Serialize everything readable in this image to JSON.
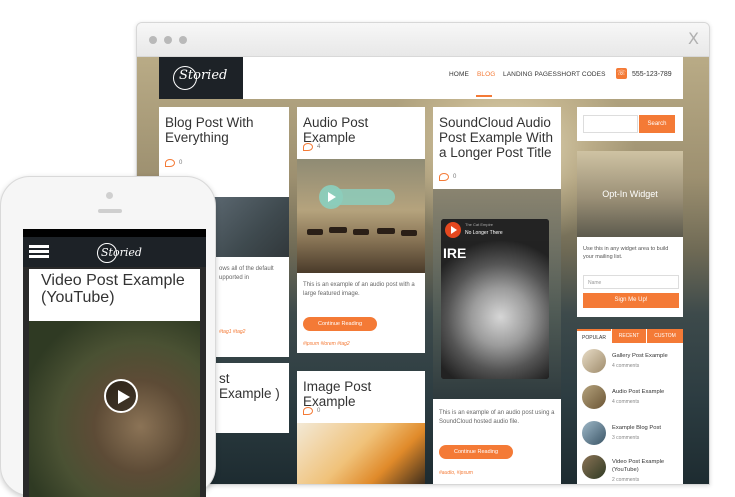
{
  "colors": {
    "accent": "#f47a36",
    "header_dark": "#1d2227"
  },
  "browser": {
    "close_glyph": "X"
  },
  "site": {
    "logo": "Storied",
    "nav": [
      "HOME",
      "BLOG",
      "LANDING PAGES",
      "SHORT CODES"
    ],
    "active_nav": "BLOG",
    "phone_icon": "phone-icon",
    "phone_number": "555-123-789"
  },
  "posts": {
    "blog": {
      "title": "Blog Post With Everything",
      "comments": "0",
      "excerpt": "ows all of the default upported in",
      "tags": "#tag1 #tag2"
    },
    "audio": {
      "title": "Audio Post Example",
      "comments": "4",
      "excerpt": "This is an example of an audio post with a large featured image.",
      "button": "Continue Reading",
      "tags": "#ipsum #lorem #tag2"
    },
    "soundcloud": {
      "title": "SoundCloud Audio Post Example With a Longer Post Title",
      "comments": "0",
      "player_artist": "The Cat Empire",
      "player_track": "No Longer There",
      "player_label": "IRE",
      "excerpt": "This is an example of an audio post using a SoundCloud hosted audio file.",
      "button": "Continue Reading",
      "tags": "#audio, #ipsum"
    },
    "image": {
      "title": "Image Post Example",
      "comments": "0"
    },
    "partial": {
      "title": "st Example )"
    }
  },
  "sidebar": {
    "search_button": "Search",
    "optin_title": "Opt-In Widget",
    "optin_desc": "Use this in any widget area to build your mailing list.",
    "name_placeholder": "Name",
    "signup_button": "Sign Me Up!",
    "tabs": [
      "POPULAR",
      "RECENT",
      "CUSTOM"
    ],
    "popular": [
      {
        "title": "Gallery Post Example",
        "comments": "4 comments"
      },
      {
        "title": "Audio Post Example",
        "comments": "4 comments"
      },
      {
        "title": "Example Blog Post",
        "comments": "3 comments"
      },
      {
        "title": "Video Post Example (YouTube)",
        "comments": "2 comments"
      }
    ]
  },
  "mobile": {
    "logo": "Storied",
    "post_title": "Video Post Example (YouTube)"
  }
}
